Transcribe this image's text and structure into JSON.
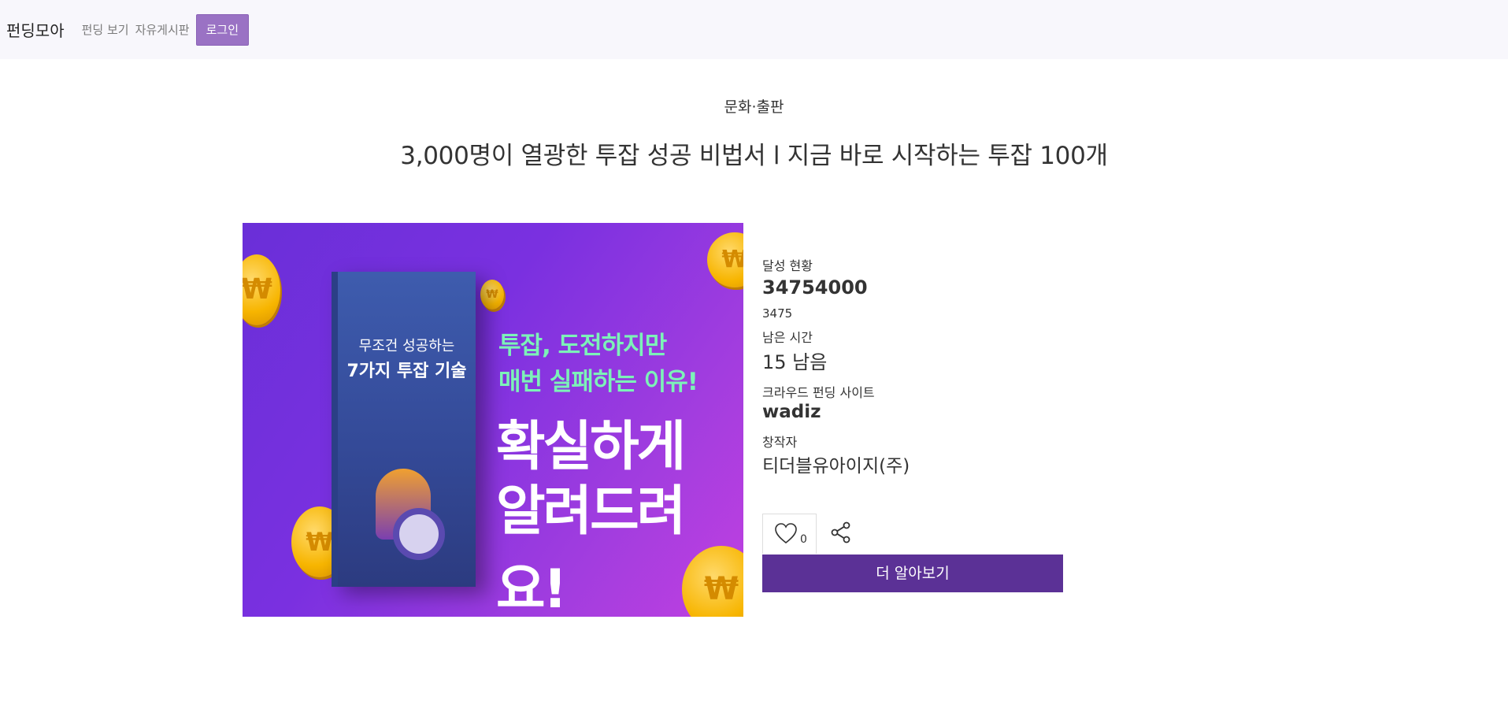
{
  "nav": {
    "brand": "펀딩모아",
    "links": [
      "펀딩 보기",
      "자유게시판"
    ],
    "login": "로그인"
  },
  "project": {
    "category": "문화·출판",
    "title": "3,000명이 열광한 투잡 성공 비법서 l 지금 바로 시작하는 투잡 100개",
    "image": {
      "book_line1": "무조건 성공하는",
      "book_line2": "7가지 투잡 기술",
      "headline1": "투잡, 도전하지만",
      "headline2": "매번 실패하는 이유!",
      "headline3": "확실하게",
      "headline4": "알려드려요!",
      "coin_symbol": "₩"
    },
    "achievement_label": "달성 현황",
    "achievement_amount": "34754000",
    "achievement_percent": "3475",
    "remaining_label": "남은 시간",
    "remaining_value": "15 남음",
    "site_label": "크라우드 펀딩 사이트",
    "site_value": "wadiz",
    "creator_label": "창작자",
    "creator_value": "티더블유아이지(주)",
    "like_count": "0",
    "more_button": "더 알아보기"
  },
  "colors": {
    "navbar_bg": "#f8f7fc",
    "login_bg": "#9a72c4",
    "more_btn_bg": "#5b3196",
    "headline_green": "#7cf2b8"
  },
  "icons": [
    "heart-icon",
    "share-icon"
  ]
}
